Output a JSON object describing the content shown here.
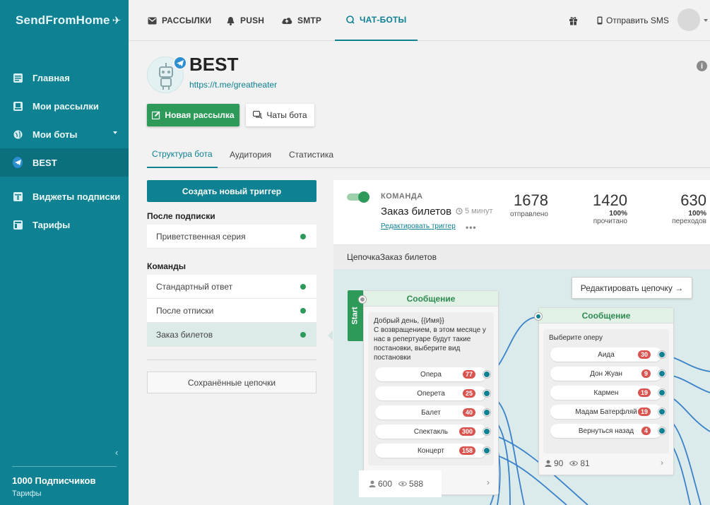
{
  "brand": {
    "name": "SendFromHome",
    "mark": "✈"
  },
  "sidebar": {
    "items": [
      {
        "label": "Главная",
        "icon": "dashboard-icon"
      },
      {
        "label": "Мои рассылки",
        "icon": "inbox-icon"
      },
      {
        "label": "Мои боты",
        "icon": "globe-icon"
      },
      {
        "label": "BEST",
        "icon": "telegram-icon"
      },
      {
        "label": "Виджеты подписки",
        "icon": "widget-icon"
      },
      {
        "label": "Тарифы",
        "icon": "window-icon"
      }
    ],
    "footer": {
      "subscribers": "1000 Подписчиков",
      "tariffs": "Тарифы"
    }
  },
  "topnav": {
    "tabs": [
      {
        "label": "РАССЫЛКИ",
        "icon": "mail-icon"
      },
      {
        "label": "PUSH",
        "icon": "bell-icon"
      },
      {
        "label": "SMTP",
        "icon": "cloud-upload-icon"
      },
      {
        "label": "ЧАТ-БОТЫ",
        "icon": "chat-icon"
      }
    ],
    "send_sms": "Отправить SMS"
  },
  "bot": {
    "title": "BEST",
    "link": "https://t.me/greatheater",
    "new_mailing": "Новая рассылка",
    "bot_chats": "Чаты бота"
  },
  "subtabs": [
    "Структура бота",
    "Аудитория",
    "Статистика"
  ],
  "left": {
    "create_trigger": "Создать новый триггер",
    "after_subscribe": "После подписки",
    "after_subscribe_items": [
      "Приветственная серия"
    ],
    "commands": "Команды",
    "command_items": [
      "Стандартный ответ",
      "После отписки",
      "Заказ билетов"
    ],
    "saved_chains": "Сохранённые цепочки"
  },
  "trigger": {
    "kicker": "КОМАНДА",
    "name": "Заказ билетов",
    "delay": "5 минут",
    "edit": "Редактировать триггер",
    "more": "•••",
    "stats": [
      {
        "value": "1678",
        "pct": "",
        "label": "отправлено"
      },
      {
        "value": "1420",
        "pct": "100%",
        "label": "прочитано"
      },
      {
        "value": "630",
        "pct": "100%",
        "label": "переходов"
      }
    ]
  },
  "chain": {
    "prefix": "Цепочка ",
    "name": "Заказ билетов",
    "edit_button": "Редактировать цепочку →",
    "start": "Start",
    "node1": {
      "header": "Сообщение",
      "text": "Добрый день,  {{Имя}}\nС возвращением, в этом месяце у нас в репертуаре будут такие постановки, выберите вид постановки",
      "options": [
        {
          "label": "Опера",
          "count": "77"
        },
        {
          "label": "Оперета",
          "count": "25"
        },
        {
          "label": "Балет",
          "count": "40"
        },
        {
          "label": "Спектакль",
          "count": "300"
        },
        {
          "label": "Концерт",
          "count": "158"
        }
      ],
      "users": "600",
      "views": "588",
      "arrow": "›"
    },
    "node2": {
      "header": "Сообщение",
      "text": "Выберите оперу",
      "options": [
        {
          "label": "Аида",
          "count": "30"
        },
        {
          "label": "Дон Жуан",
          "count": "9"
        },
        {
          "label": "Кармен",
          "count": "19"
        },
        {
          "label": "Мадам Батерфляй",
          "count": "19"
        },
        {
          "label": "Вернуться назад",
          "count": "4"
        }
      ],
      "users": "90",
      "views": "81",
      "arrow": "›"
    }
  },
  "colors": {
    "brand": "#0e8193",
    "green": "#2d9a5a",
    "badge": "#d9534f"
  }
}
